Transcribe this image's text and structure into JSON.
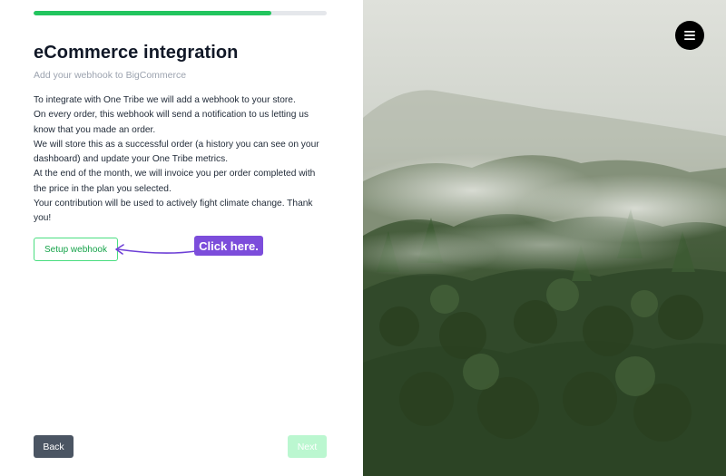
{
  "progress": {
    "value": 0.81,
    "color": "#22c55e"
  },
  "header": {
    "title": "eCommerce integration",
    "subtitle": "Add your webhook to BigCommerce"
  },
  "body": {
    "paragraphs": [
      "To integrate with One Tribe we will add a webhook to your store.",
      "On every order, this webhook will send a notification to us letting us know that you made an order.",
      "We will store this as a successful order (a history you can see on your dashboard) and update your One Tribe metrics.",
      "At the end of the month, we will invoice you per order completed with the price in the plan you selected.",
      "Your contribution will be used to actively fight climate change. Thank you!"
    ]
  },
  "actions": {
    "setup_webhook_label": "Setup webhook",
    "callout_label": "Click here.",
    "back_label": "Back",
    "next_label": "Next"
  },
  "icons": {
    "menu": "hamburger-menu-icon",
    "arrow": "left-arrow-icon"
  },
  "colors": {
    "accent_green": "#22c55e",
    "button_green_border": "#4ade80",
    "callout_purple": "#7c4ddb",
    "back_button": "#4b5563",
    "next_disabled": "#bbf7d0"
  }
}
